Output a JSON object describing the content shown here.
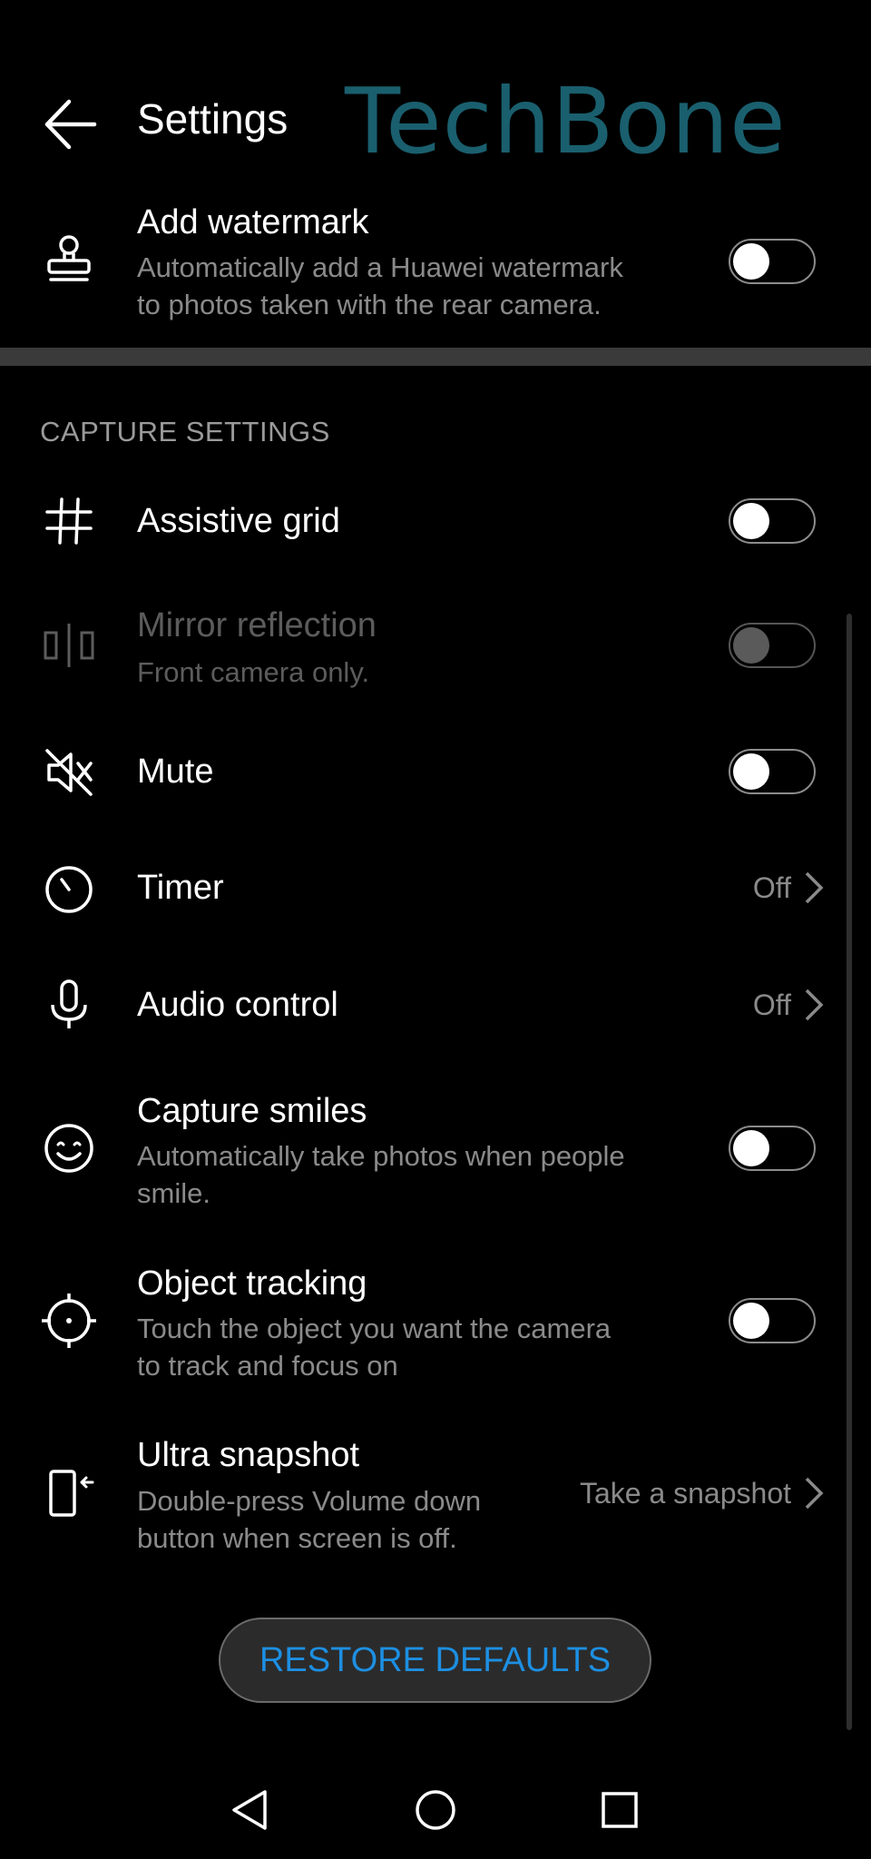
{
  "header": {
    "title": "Settings",
    "watermark_text": "TechBone"
  },
  "watermark_row": {
    "title": "Add watermark",
    "subtitle_line1": "Automatically add a Huawei watermark",
    "subtitle_line2": "to photos taken with the rear camera.",
    "toggle_on": false,
    "icon": "stamp-icon"
  },
  "section_header": "CAPTURE SETTINGS",
  "rows": {
    "assistive_grid": {
      "title": "Assistive grid",
      "toggle_on": false,
      "icon": "grid-icon"
    },
    "mirror_reflection": {
      "title": "Mirror reflection",
      "subtitle": "Front camera only.",
      "toggle_on": false,
      "disabled": true,
      "icon": "mirror-icon"
    },
    "mute": {
      "title": "Mute",
      "toggle_on": false,
      "icon": "speaker-muted-icon"
    },
    "timer": {
      "title": "Timer",
      "value": "Off",
      "icon": "timer-icon"
    },
    "audio_control": {
      "title": "Audio control",
      "value": "Off",
      "icon": "microphone-icon"
    },
    "capture_smiles": {
      "title": "Capture smiles",
      "subtitle_line1": "Automatically take photos when people",
      "subtitle_line2": "smile.",
      "toggle_on": false,
      "icon": "smile-icon"
    },
    "object_tracking": {
      "title": "Object tracking",
      "subtitle_line1": "Touch the object you want the camera",
      "subtitle_line2": "to track and focus on",
      "toggle_on": false,
      "icon": "crosshair-icon"
    },
    "ultra_snapshot": {
      "title": "Ultra snapshot",
      "subtitle_line1": "Double-press Volume down",
      "subtitle_line2": "button when screen is off.",
      "value": "Take a snapshot",
      "icon": "phone-snapshot-icon"
    }
  },
  "restore_button": "RESTORE DEFAULTS",
  "navbar": {
    "back": "back-triangle-icon",
    "home": "home-circle-icon",
    "recents": "recents-square-icon"
  },
  "colors": {
    "accent": "#1d8fe2",
    "watermark": "#1a5f6e",
    "background": "#000000",
    "secondary_text": "#8a8a8a"
  }
}
